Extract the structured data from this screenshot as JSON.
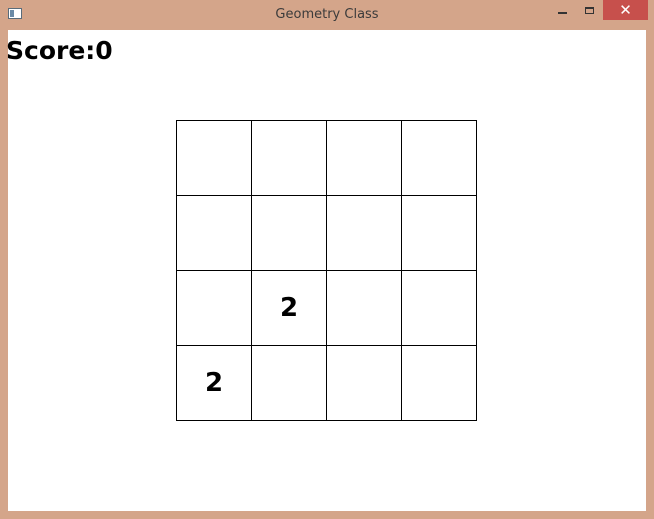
{
  "window": {
    "title": "Geometry Class",
    "close_label": "✕"
  },
  "score": {
    "text": "Score:0"
  },
  "board": {
    "rows": [
      [
        "",
        "",
        "",
        ""
      ],
      [
        "",
        "",
        "",
        ""
      ],
      [
        "",
        "2",
        "",
        ""
      ],
      [
        "2",
        "",
        "",
        ""
      ]
    ]
  }
}
